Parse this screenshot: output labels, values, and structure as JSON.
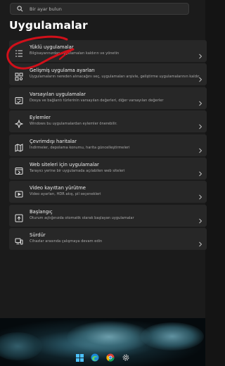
{
  "search": {
    "placeholder": "Bir ayar bulun"
  },
  "page": {
    "title": "Uygulamalar"
  },
  "items": [
    {
      "title": "Yüklü uygulamalar",
      "subtitle": "Bilgisayarınızdan uygulamaları kaldırın ve yönetin",
      "icon": "installed-apps-icon"
    },
    {
      "title": "Gelişmiş uygulama ayarları",
      "subtitle": "Uygulamaların nereden alınacağını seç, uygulamaları arşivle, geliştirme uygulamalarının kaldır",
      "icon": "advanced-settings-icon"
    },
    {
      "title": "Varsayılan uygulamalar",
      "subtitle": "Dosya ve bağlantı türlerinin varsayılan değerleri, diğer varsayılan değerler",
      "icon": "default-apps-icon"
    },
    {
      "title": "Eylemler",
      "subtitle": "Windows bu uygulamalardan eylemler önerebilir.",
      "icon": "actions-icon"
    },
    {
      "title": "Çevrimdışı haritalar",
      "subtitle": "İndirmeler, depolama konumu, harita güncelleştirmeleri",
      "icon": "offline-maps-icon"
    },
    {
      "title": "Web siteleri için uygulamalar",
      "subtitle": "Tarayıcı yerine bir uygulamada açılabilen web siteleri",
      "icon": "apps-for-websites-icon"
    },
    {
      "title": "Video kayıttan yürütme",
      "subtitle": "Video ayarları, HDR akış, pil seçenekleri",
      "icon": "video-playback-icon"
    },
    {
      "title": "Başlangıç",
      "subtitle": "Oturum açtığınızda otomatik olarak başlayan uygulamalar",
      "icon": "startup-icon"
    },
    {
      "title": "Sürdür",
      "subtitle": "Cihazlar arasında çalışmaya devam edin",
      "icon": "resume-icon"
    }
  ],
  "colors": {
    "background": "#1b1b1b",
    "card": "#272727",
    "annotation": "#d0101a"
  },
  "taskbar": [
    "windows-start-icon",
    "edge-icon",
    "chrome-icon",
    "settings-gear-icon"
  ]
}
